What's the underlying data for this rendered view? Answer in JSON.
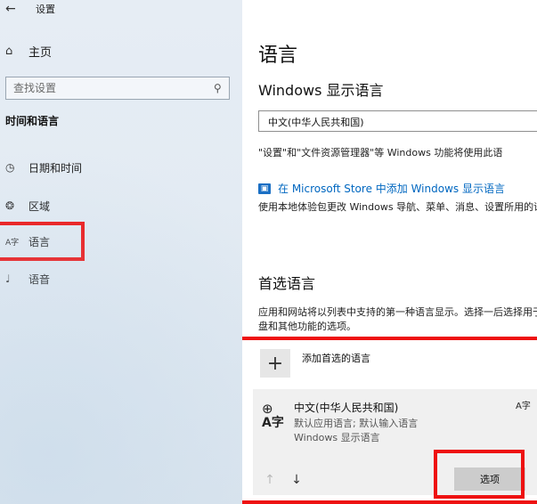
{
  "window": {
    "back_glyph": "←",
    "app_title": "设置"
  },
  "sidebar": {
    "home_label": "主页",
    "search_placeholder": "查找设置",
    "section_heading": "时间和语言",
    "items": [
      {
        "label": "日期和时间",
        "icon": "calendar-clock-icon",
        "glyph": "◷"
      },
      {
        "label": "区域",
        "icon": "region-globe-icon",
        "glyph": "❂"
      },
      {
        "label": "语言",
        "icon": "language-icon",
        "glyph": "A字"
      },
      {
        "label": "语音",
        "icon": "microphone-icon",
        "glyph": "♩"
      }
    ]
  },
  "main": {
    "page_title": "语言",
    "windows_display_language_heading": "Windows 显示语言",
    "display_language_value": "中文(中华人民共和国)",
    "display_language_desc": "\"设置\"和\"文件资源管理器\"等 Windows 功能将使用此语",
    "store_link_label": "在 Microsoft Store 中添加 Windows 显示语言",
    "store_desc": "使用本地体验包更改 Windows 导航、菜单、消息、设置所用的语言。",
    "preferred_heading": "首选语言",
    "preferred_desc": "应用和网站将以列表中支持的第一种语言显示。选择一后选择用于配置键盘和其他功能的选项。",
    "add_label": "添加首选的语言",
    "language_item": {
      "name": "中文(中华人民共和国)",
      "line1": "默认应用语言; 默认输入语言",
      "line2": "Windows 显示语言",
      "badge": "A字"
    },
    "options_label": "选项"
  },
  "colors": {
    "highlight": "#e11111",
    "link": "#0067c0",
    "sidebar_bg": "#e4ecf3",
    "options_button": "#cccccc"
  }
}
